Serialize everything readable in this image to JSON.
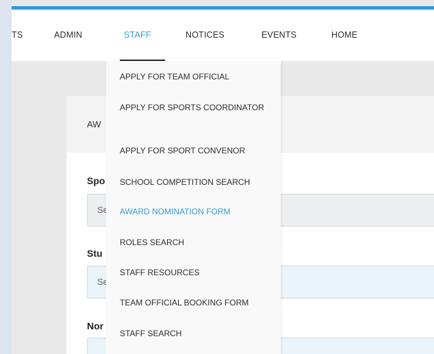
{
  "navbar": {
    "items": [
      {
        "label": "TS"
      },
      {
        "label": "ADMIN"
      },
      {
        "label": "STAFF",
        "active": true
      },
      {
        "label": "NOTICES"
      },
      {
        "label": "EVENTS"
      },
      {
        "label": "HOME"
      }
    ]
  },
  "staff_menu": {
    "items": [
      {
        "label": "APPLY FOR TEAM OFFICIAL"
      },
      {
        "label": "APPLY FOR SPORTS COORDINATOR"
      },
      {
        "label": "APPLY FOR SPORT CONVENOR"
      },
      {
        "label": "SCHOOL COMPETITION SEARCH"
      },
      {
        "label": "AWARD NOMINATION FORM",
        "active": true
      },
      {
        "label": "ROLES SEARCH"
      },
      {
        "label": "STAFF RESOURCES"
      },
      {
        "label": "TEAM OFFICIAL BOOKING FORM"
      },
      {
        "label": "STAFF SEARCH"
      }
    ]
  },
  "form": {
    "title": "AW",
    "fields": [
      {
        "label": "Spo",
        "value": "Se"
      },
      {
        "label": "Stu",
        "value": "Se"
      },
      {
        "label": "Nor",
        "value": ""
      }
    ]
  },
  "colors": {
    "accent": "#2f9bd8",
    "page_bg": "#e9e9e9",
    "outer_bg": "#dde4f0"
  }
}
